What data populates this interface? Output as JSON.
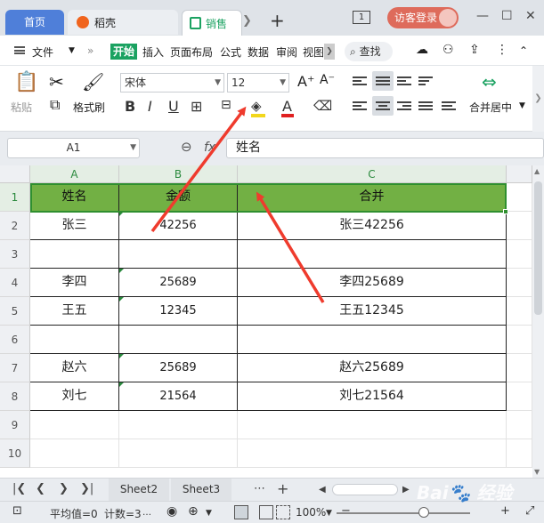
{
  "titlebar": {
    "home_tab": "首页",
    "doc_tab": "稻壳",
    "current_tab": "销售",
    "window_count": "1",
    "login": "访客登录"
  },
  "menu": {
    "file": "文件",
    "start": "开始",
    "items": [
      "插入",
      "页面布局",
      "公式",
      "数据",
      "审阅",
      "视图"
    ],
    "search": "查找"
  },
  "ribbon": {
    "paste": "粘贴",
    "format_painter": "格式刷",
    "font": "宋体",
    "size": "12",
    "merge_center": "合并居中",
    "fill_color": "#f2d71c",
    "font_color": "#e02020"
  },
  "formula_bar": {
    "cell_ref": "A1",
    "fx": "fx",
    "content": "姓名"
  },
  "grid": {
    "columns": [
      "A",
      "B",
      "C"
    ],
    "rows": [
      "1",
      "2",
      "3",
      "4",
      "5",
      "6",
      "7",
      "8",
      "9",
      "10"
    ],
    "header": [
      "姓名",
      "金额",
      "合并"
    ],
    "data": [
      [
        "张三",
        "42256",
        "张三42256"
      ],
      [
        "",
        "",
        ""
      ],
      [
        "李四",
        "25689",
        "李四25689"
      ],
      [
        "王五",
        "12345",
        "王五12345"
      ],
      [
        "",
        "",
        ""
      ],
      [
        "赵六",
        "25689",
        "赵六25689"
      ],
      [
        "刘七",
        "21564",
        "刘七21564"
      ]
    ]
  },
  "sheets": {
    "tabs": [
      "Sheet2",
      "Sheet3"
    ]
  },
  "status": {
    "average": "平均值=0",
    "count": "计数=3",
    "zoom": "100%"
  },
  "colors": {
    "accent": "#1ba261",
    "header_fill": "#72b044",
    "arrow": "#ef3b2d"
  }
}
